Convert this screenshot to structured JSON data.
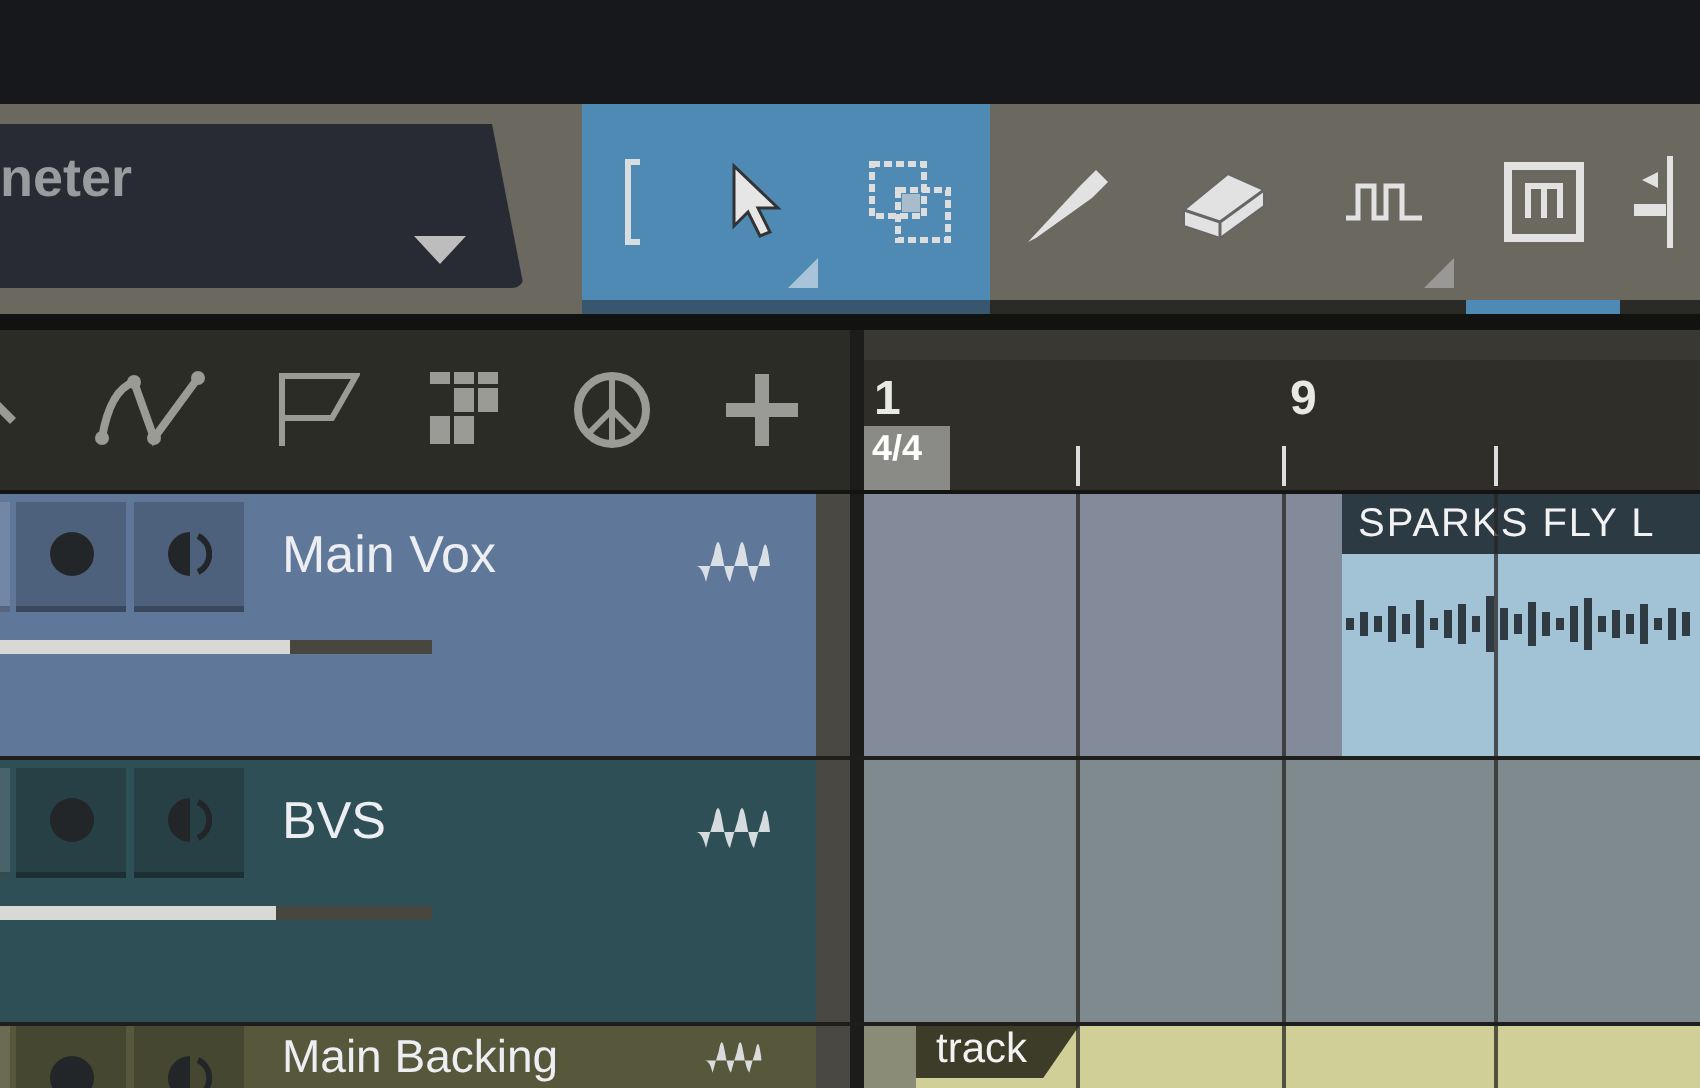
{
  "preset_selector": {
    "value": "neter"
  },
  "tools": [
    {
      "kind": "bracket",
      "selected": true,
      "has_menu": false,
      "active": false
    },
    {
      "kind": "arrow",
      "selected": true,
      "has_menu": true,
      "active": false
    },
    {
      "kind": "range",
      "selected": true,
      "has_menu": false,
      "active": false
    },
    {
      "kind": "knife",
      "selected": false,
      "has_menu": false,
      "active": false
    },
    {
      "kind": "eraser",
      "selected": false,
      "has_menu": false,
      "active": false
    },
    {
      "kind": "pulse",
      "selected": false,
      "has_menu": true,
      "active": false
    },
    {
      "kind": "mute",
      "selected": false,
      "has_menu": false,
      "active": true
    },
    {
      "kind": "split",
      "selected": false,
      "has_menu": false,
      "active": false
    }
  ],
  "ruler": {
    "bars": [
      "1",
      "9"
    ],
    "time_signature": "4/4"
  },
  "tracks": [
    {
      "name": "Main Vox",
      "color": "#5f7799",
      "level": 0.67,
      "event": {
        "name": "SPARKS FLY L",
        "kind": "vocal"
      }
    },
    {
      "name": "BVS",
      "color": "#2f4f56",
      "level": 0.64
    },
    {
      "name": "Main Backing",
      "color": "#56573b",
      "event": {
        "name": "track",
        "kind": "backing"
      }
    }
  ]
}
